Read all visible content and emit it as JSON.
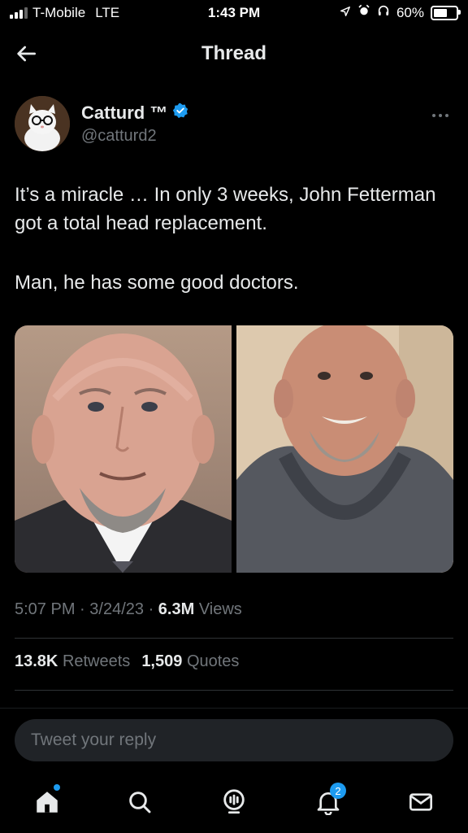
{
  "status": {
    "carrier": "T-Mobile",
    "network": "LTE",
    "time": "1:43 PM",
    "battery": "60%",
    "battery_level": 0.6
  },
  "header": {
    "title": "Thread"
  },
  "tweet": {
    "author_name": "Catturd ™",
    "author_handle": "@catturd2",
    "text_line1": "It’s a miracle … In only 3 weeks, John Fetterman got a total head replacement.",
    "text_line2": "Man, he has some good doctors.",
    "time": "5:07 PM",
    "date": "3/24/23",
    "views_count": "6.3M",
    "views_label": "Views",
    "retweets_count": "13.8K",
    "retweets_label": "Retweets",
    "quotes_count": "1,509",
    "quotes_label": "Quotes"
  },
  "reply": {
    "placeholder": "Tweet your reply"
  },
  "tabbar": {
    "notifications_badge": "2"
  },
  "colors": {
    "accent": "#1d9bf0",
    "background": "#000000",
    "secondary_text": "#71767b"
  },
  "icons": [
    "back-arrow-icon",
    "verified-badge-icon",
    "more-icon",
    "home-icon",
    "search-icon",
    "spaces-icon",
    "notifications-icon",
    "messages-icon"
  ]
}
